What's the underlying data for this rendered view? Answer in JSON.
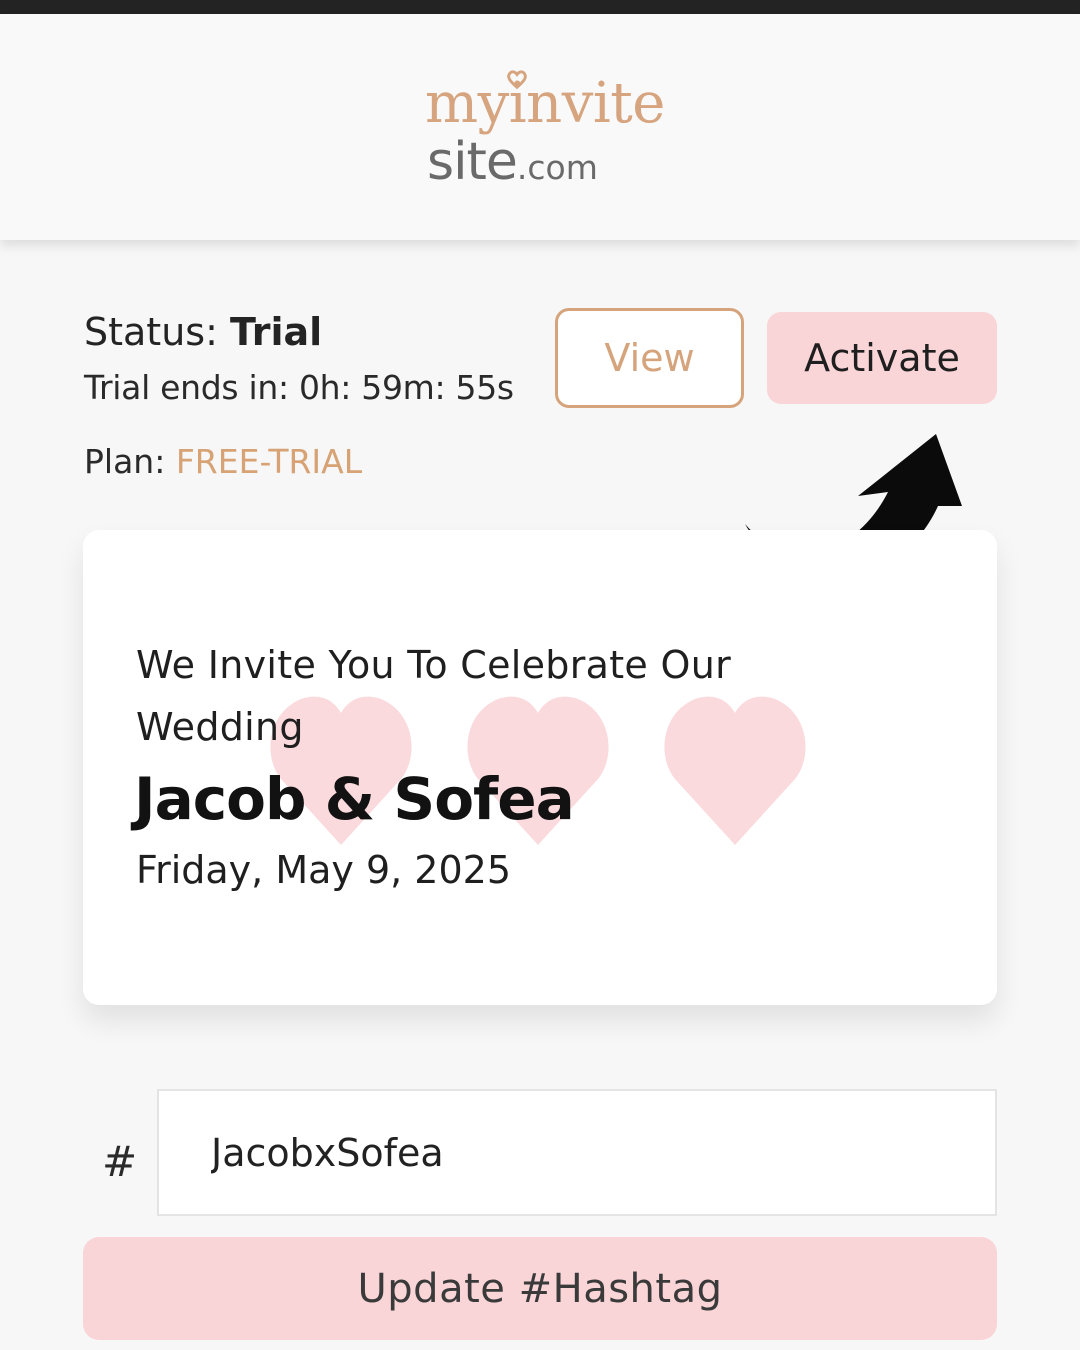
{
  "header": {
    "logo": {
      "line1": "myinvite",
      "line2": "site",
      "suffix": ".com",
      "heart_color": "#d6a57f",
      "text_color": "#d6a57f",
      "secondary_color": "#6a6a6a"
    }
  },
  "status": {
    "label": "Status: ",
    "value": "Trial",
    "trial_ends_text": "Trial ends in: 0h: 59m: 55s",
    "plan_label": "Plan: ",
    "plan_value": "FREE-TRIAL"
  },
  "actions": {
    "view_label": "View",
    "activate_label": "Activate",
    "arrow_icon": "curved-arrow-icon"
  },
  "invitation": {
    "intro": "We Invite You To Celebrate Our Wedding",
    "couple": "Jacob & Sofea",
    "date": "Friday, May 9, 2025",
    "decoration_icon": "heart-icon",
    "decoration_color": "#fadadd"
  },
  "hashtag": {
    "prefix": "#",
    "value": "JacobxSofea",
    "update_label": "Update #Hashtag"
  },
  "colors": {
    "accent": "#d5a47c",
    "primary_button": "#f9d5d8",
    "background": "#f7f7f7"
  }
}
